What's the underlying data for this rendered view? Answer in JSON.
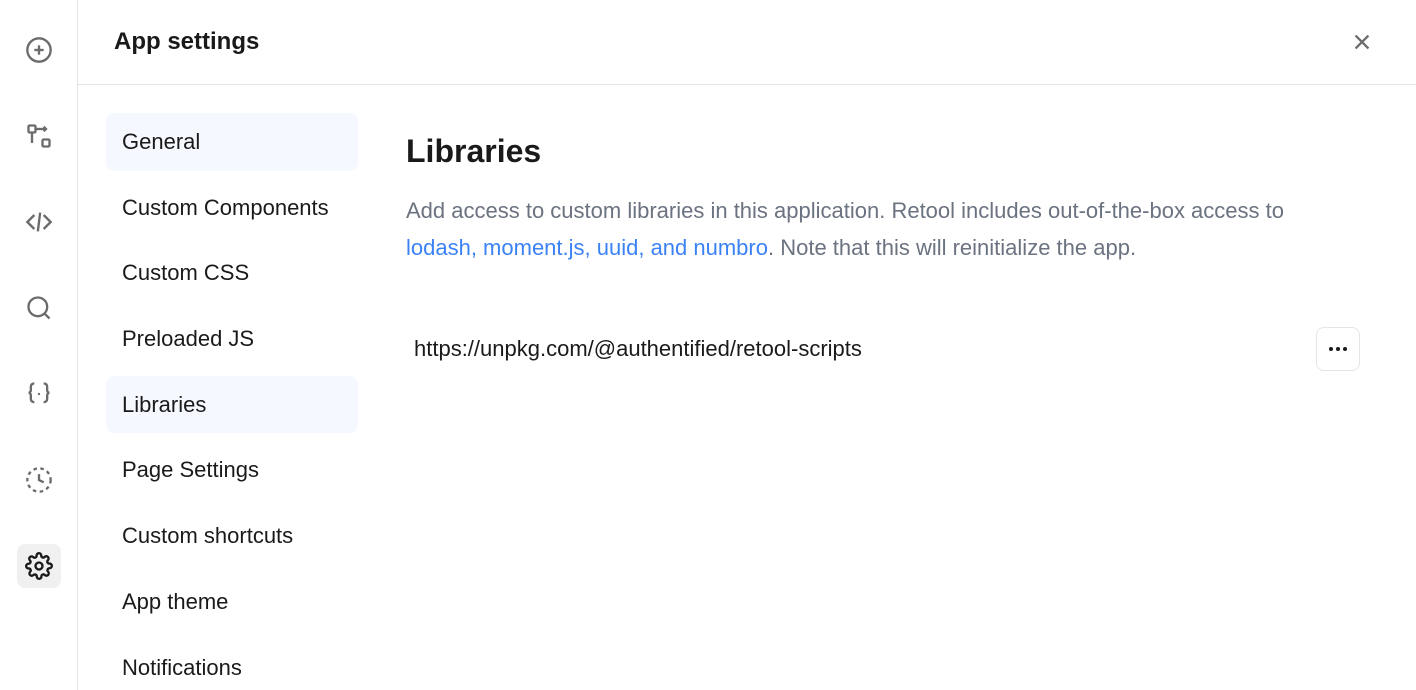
{
  "header": {
    "title": "App settings"
  },
  "nav": {
    "items": [
      {
        "label": "General",
        "selected": true
      },
      {
        "label": "Custom Components",
        "selected": false
      },
      {
        "label": "Custom CSS",
        "selected": false
      },
      {
        "label": "Preloaded JS",
        "selected": false
      },
      {
        "label": "Libraries",
        "selected": true
      },
      {
        "label": "Page Settings",
        "selected": false
      },
      {
        "label": "Custom shortcuts",
        "selected": false
      },
      {
        "label": "App theme",
        "selected": false
      },
      {
        "label": "Notifications",
        "selected": false
      }
    ]
  },
  "content": {
    "heading": "Libraries",
    "desc_prefix": "Add access to custom libraries in this application. Retool includes out-of-the-box access to ",
    "desc_link": "lodash, moment.js, uuid, and numbro",
    "desc_suffix": ". Note that this will reinitialize the app.",
    "libraries": [
      {
        "url": "https://unpkg.com/@authentified/retool-scripts"
      }
    ]
  },
  "rail": {
    "icons": [
      "plus-circle-icon",
      "flow-icon",
      "code-icon",
      "search-icon",
      "braces-icon",
      "clock-icon",
      "gear-icon"
    ],
    "active": "gear-icon"
  }
}
